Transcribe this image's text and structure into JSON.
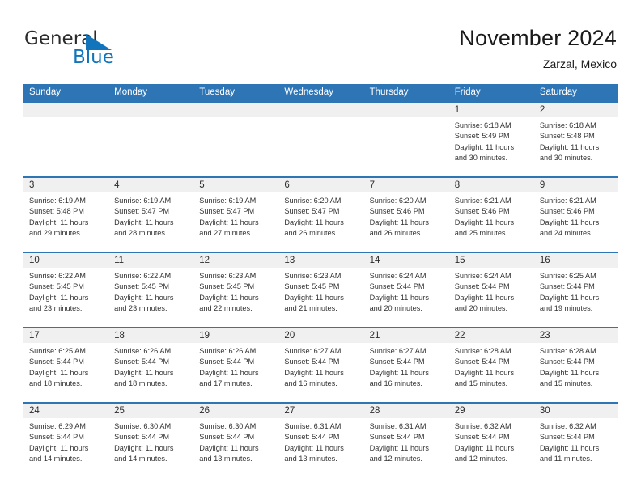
{
  "brand": {
    "name_part1": "General",
    "name_part2": "Blue",
    "colors": {
      "blue": "#1275bc",
      "dark": "#2b2b2b"
    }
  },
  "header": {
    "title": "November 2024",
    "subtitle": "Zarzal, Mexico"
  },
  "theme": {
    "header_blue": "#2e75b6",
    "band_gray": "#f0f0f0",
    "text": "#333333"
  },
  "columns": [
    "Sunday",
    "Monday",
    "Tuesday",
    "Wednesday",
    "Thursday",
    "Friday",
    "Saturday"
  ],
  "weeks": [
    [
      {
        "day": "",
        "empty": true,
        "sunrise": "",
        "sunset": "",
        "daylight1": "",
        "daylight2": ""
      },
      {
        "day": "",
        "empty": true,
        "sunrise": "",
        "sunset": "",
        "daylight1": "",
        "daylight2": ""
      },
      {
        "day": "",
        "empty": true,
        "sunrise": "",
        "sunset": "",
        "daylight1": "",
        "daylight2": ""
      },
      {
        "day": "",
        "empty": true,
        "sunrise": "",
        "sunset": "",
        "daylight1": "",
        "daylight2": ""
      },
      {
        "day": "",
        "empty": true,
        "sunrise": "",
        "sunset": "",
        "daylight1": "",
        "daylight2": ""
      },
      {
        "day": "1",
        "empty": false,
        "sunrise": "Sunrise: 6:18 AM",
        "sunset": "Sunset: 5:49 PM",
        "daylight1": "Daylight: 11 hours",
        "daylight2": "and 30 minutes."
      },
      {
        "day": "2",
        "empty": false,
        "sunrise": "Sunrise: 6:18 AM",
        "sunset": "Sunset: 5:48 PM",
        "daylight1": "Daylight: 11 hours",
        "daylight2": "and 30 minutes."
      }
    ],
    [
      {
        "day": "3",
        "empty": false,
        "sunrise": "Sunrise: 6:19 AM",
        "sunset": "Sunset: 5:48 PM",
        "daylight1": "Daylight: 11 hours",
        "daylight2": "and 29 minutes."
      },
      {
        "day": "4",
        "empty": false,
        "sunrise": "Sunrise: 6:19 AM",
        "sunset": "Sunset: 5:47 PM",
        "daylight1": "Daylight: 11 hours",
        "daylight2": "and 28 minutes."
      },
      {
        "day": "5",
        "empty": false,
        "sunrise": "Sunrise: 6:19 AM",
        "sunset": "Sunset: 5:47 PM",
        "daylight1": "Daylight: 11 hours",
        "daylight2": "and 27 minutes."
      },
      {
        "day": "6",
        "empty": false,
        "sunrise": "Sunrise: 6:20 AM",
        "sunset": "Sunset: 5:47 PM",
        "daylight1": "Daylight: 11 hours",
        "daylight2": "and 26 minutes."
      },
      {
        "day": "7",
        "empty": false,
        "sunrise": "Sunrise: 6:20 AM",
        "sunset": "Sunset: 5:46 PM",
        "daylight1": "Daylight: 11 hours",
        "daylight2": "and 26 minutes."
      },
      {
        "day": "8",
        "empty": false,
        "sunrise": "Sunrise: 6:21 AM",
        "sunset": "Sunset: 5:46 PM",
        "daylight1": "Daylight: 11 hours",
        "daylight2": "and 25 minutes."
      },
      {
        "day": "9",
        "empty": false,
        "sunrise": "Sunrise: 6:21 AM",
        "sunset": "Sunset: 5:46 PM",
        "daylight1": "Daylight: 11 hours",
        "daylight2": "and 24 minutes."
      }
    ],
    [
      {
        "day": "10",
        "empty": false,
        "sunrise": "Sunrise: 6:22 AM",
        "sunset": "Sunset: 5:45 PM",
        "daylight1": "Daylight: 11 hours",
        "daylight2": "and 23 minutes."
      },
      {
        "day": "11",
        "empty": false,
        "sunrise": "Sunrise: 6:22 AM",
        "sunset": "Sunset: 5:45 PM",
        "daylight1": "Daylight: 11 hours",
        "daylight2": "and 23 minutes."
      },
      {
        "day": "12",
        "empty": false,
        "sunrise": "Sunrise: 6:23 AM",
        "sunset": "Sunset: 5:45 PM",
        "daylight1": "Daylight: 11 hours",
        "daylight2": "and 22 minutes."
      },
      {
        "day": "13",
        "empty": false,
        "sunrise": "Sunrise: 6:23 AM",
        "sunset": "Sunset: 5:45 PM",
        "daylight1": "Daylight: 11 hours",
        "daylight2": "and 21 minutes."
      },
      {
        "day": "14",
        "empty": false,
        "sunrise": "Sunrise: 6:24 AM",
        "sunset": "Sunset: 5:44 PM",
        "daylight1": "Daylight: 11 hours",
        "daylight2": "and 20 minutes."
      },
      {
        "day": "15",
        "empty": false,
        "sunrise": "Sunrise: 6:24 AM",
        "sunset": "Sunset: 5:44 PM",
        "daylight1": "Daylight: 11 hours",
        "daylight2": "and 20 minutes."
      },
      {
        "day": "16",
        "empty": false,
        "sunrise": "Sunrise: 6:25 AM",
        "sunset": "Sunset: 5:44 PM",
        "daylight1": "Daylight: 11 hours",
        "daylight2": "and 19 minutes."
      }
    ],
    [
      {
        "day": "17",
        "empty": false,
        "sunrise": "Sunrise: 6:25 AM",
        "sunset": "Sunset: 5:44 PM",
        "daylight1": "Daylight: 11 hours",
        "daylight2": "and 18 minutes."
      },
      {
        "day": "18",
        "empty": false,
        "sunrise": "Sunrise: 6:26 AM",
        "sunset": "Sunset: 5:44 PM",
        "daylight1": "Daylight: 11 hours",
        "daylight2": "and 18 minutes."
      },
      {
        "day": "19",
        "empty": false,
        "sunrise": "Sunrise: 6:26 AM",
        "sunset": "Sunset: 5:44 PM",
        "daylight1": "Daylight: 11 hours",
        "daylight2": "and 17 minutes."
      },
      {
        "day": "20",
        "empty": false,
        "sunrise": "Sunrise: 6:27 AM",
        "sunset": "Sunset: 5:44 PM",
        "daylight1": "Daylight: 11 hours",
        "daylight2": "and 16 minutes."
      },
      {
        "day": "21",
        "empty": false,
        "sunrise": "Sunrise: 6:27 AM",
        "sunset": "Sunset: 5:44 PM",
        "daylight1": "Daylight: 11 hours",
        "daylight2": "and 16 minutes."
      },
      {
        "day": "22",
        "empty": false,
        "sunrise": "Sunrise: 6:28 AM",
        "sunset": "Sunset: 5:44 PM",
        "daylight1": "Daylight: 11 hours",
        "daylight2": "and 15 minutes."
      },
      {
        "day": "23",
        "empty": false,
        "sunrise": "Sunrise: 6:28 AM",
        "sunset": "Sunset: 5:44 PM",
        "daylight1": "Daylight: 11 hours",
        "daylight2": "and 15 minutes."
      }
    ],
    [
      {
        "day": "24",
        "empty": false,
        "sunrise": "Sunrise: 6:29 AM",
        "sunset": "Sunset: 5:44 PM",
        "daylight1": "Daylight: 11 hours",
        "daylight2": "and 14 minutes."
      },
      {
        "day": "25",
        "empty": false,
        "sunrise": "Sunrise: 6:30 AM",
        "sunset": "Sunset: 5:44 PM",
        "daylight1": "Daylight: 11 hours",
        "daylight2": "and 14 minutes."
      },
      {
        "day": "26",
        "empty": false,
        "sunrise": "Sunrise: 6:30 AM",
        "sunset": "Sunset: 5:44 PM",
        "daylight1": "Daylight: 11 hours",
        "daylight2": "and 13 minutes."
      },
      {
        "day": "27",
        "empty": false,
        "sunrise": "Sunrise: 6:31 AM",
        "sunset": "Sunset: 5:44 PM",
        "daylight1": "Daylight: 11 hours",
        "daylight2": "and 13 minutes."
      },
      {
        "day": "28",
        "empty": false,
        "sunrise": "Sunrise: 6:31 AM",
        "sunset": "Sunset: 5:44 PM",
        "daylight1": "Daylight: 11 hours",
        "daylight2": "and 12 minutes."
      },
      {
        "day": "29",
        "empty": false,
        "sunrise": "Sunrise: 6:32 AM",
        "sunset": "Sunset: 5:44 PM",
        "daylight1": "Daylight: 11 hours",
        "daylight2": "and 12 minutes."
      },
      {
        "day": "30",
        "empty": false,
        "sunrise": "Sunrise: 6:32 AM",
        "sunset": "Sunset: 5:44 PM",
        "daylight1": "Daylight: 11 hours",
        "daylight2": "and 11 minutes."
      }
    ]
  ]
}
